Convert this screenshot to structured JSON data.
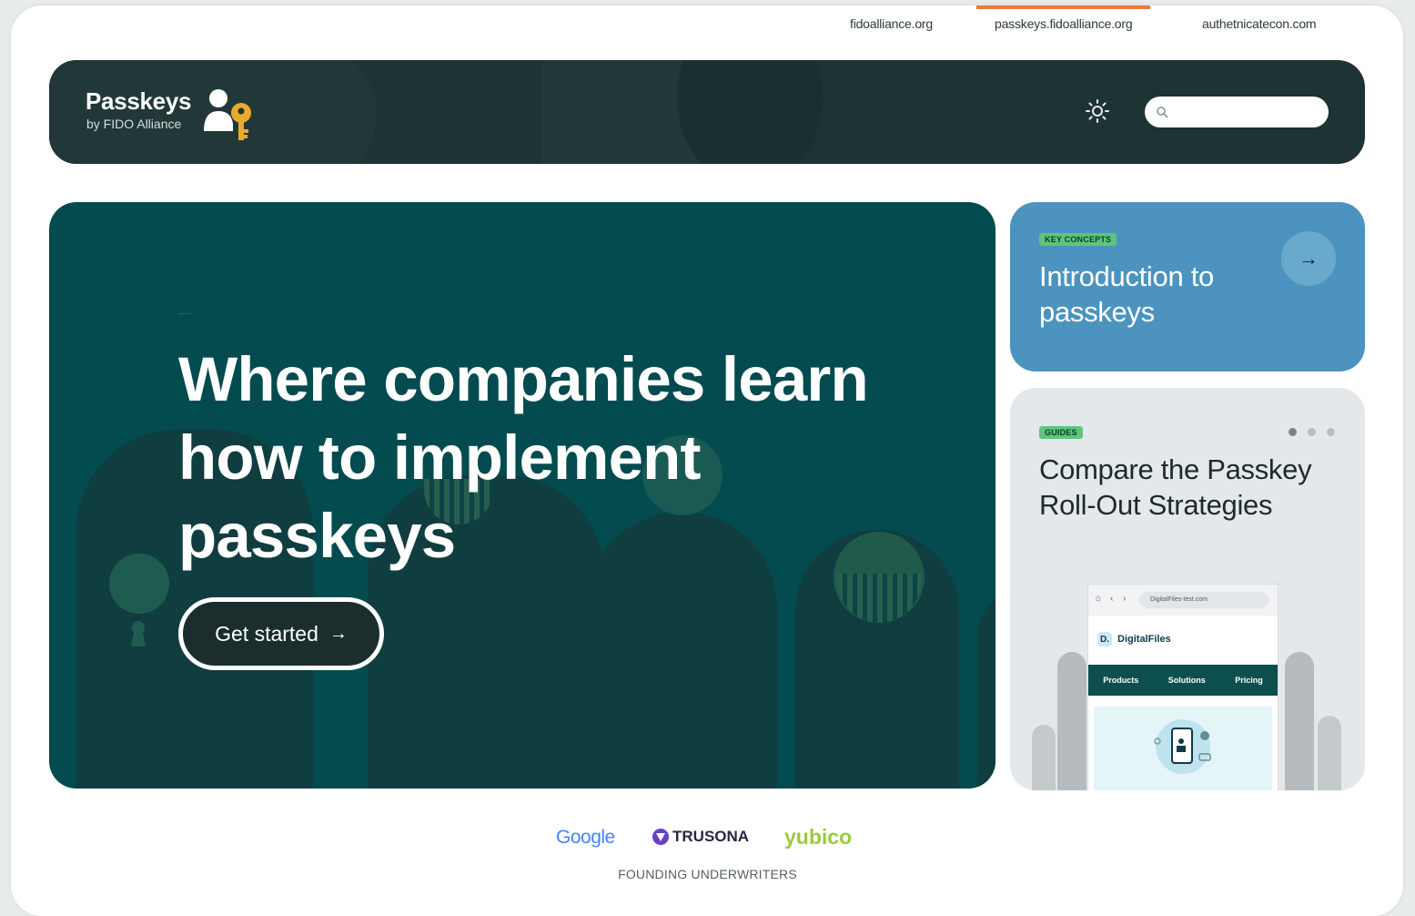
{
  "site_links": [
    {
      "label": "fidoalliance.org",
      "active": false
    },
    {
      "label": "passkeys.fidoalliance.org",
      "active": true
    },
    {
      "label": "authetnicatecon.com",
      "active": false
    }
  ],
  "header": {
    "logo_title": "Passkeys",
    "logo_subtitle": "by FIDO Alliance",
    "search_placeholder": ""
  },
  "hero": {
    "title": "Where companies learn how to implement passkeys",
    "cta_label": "Get started"
  },
  "cards": {
    "intro": {
      "tag": "KEY CONCEPTS",
      "title": "Introduction to passkeys"
    },
    "guide": {
      "tag": "GUIDES",
      "title": "Compare the Passkey Roll-Out Strategies",
      "carousel_total": 3,
      "carousel_active": 1,
      "illustration": {
        "url": "DigitalFiles-test.com",
        "brand_mark": "D.",
        "brand_name": "DigitalFiles",
        "nav": [
          "Products",
          "Solutions",
          "Pricing"
        ]
      }
    }
  },
  "underwriters": {
    "brands": [
      "Google",
      "TRUSONA",
      "yubico"
    ],
    "label": "FOUNDING UNDERWRITERS"
  },
  "colors": {
    "accent": "#ea7a3b",
    "header_bg": "#1e3333",
    "hero_bg": "#034b4f",
    "intro_card_bg": "#4c94bf",
    "tag_green": "#5ec67c",
    "key_gold": "#e9ab2c"
  }
}
